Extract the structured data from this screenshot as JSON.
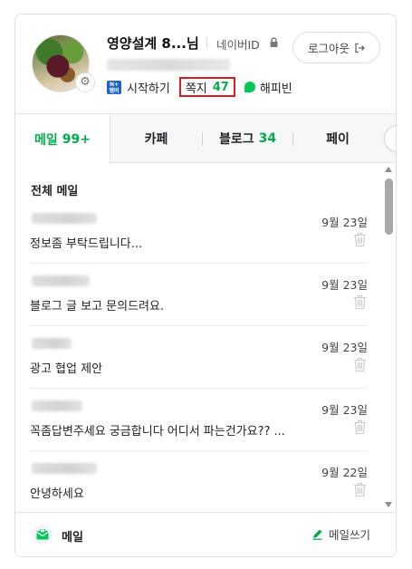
{
  "profile": {
    "name": "영양설계 8...님",
    "id_label": "네이버ID",
    "logout_label": "로그아웃",
    "links": {
      "start_badge": "N+",
      "start_badge_sub": "멤버십",
      "start_label": "시작하기",
      "note_label": "쪽지",
      "note_count": "47",
      "happybean_label": "해피빈"
    }
  },
  "tabs": [
    {
      "label": "메일",
      "count": "99+",
      "active": true
    },
    {
      "label": "카페",
      "count": ""
    },
    {
      "label": "블로그",
      "count": "34"
    },
    {
      "label": "페이",
      "count": ""
    }
  ],
  "mail": {
    "section_title": "전체 메일",
    "items": [
      {
        "date": "9월 23일",
        "subject": "정보좀 부탁드립니다..."
      },
      {
        "date": "9월 23일",
        "subject": "블로그 글 보고 문의드려요."
      },
      {
        "date": "9월 23일",
        "subject": "광고 협업 제안"
      },
      {
        "date": "9월 23일",
        "subject": "꼭좀답변주세요 궁금합니다 어디서 파는건가요?? ..."
      },
      {
        "date": "9월 22일",
        "subject": "안녕하세요"
      }
    ]
  },
  "footer": {
    "mail_label": "메일",
    "compose_label": "메일쓰기"
  },
  "colors": {
    "accent_green": "#03a94d",
    "highlight_red": "#d21f26",
    "tab_bar_bg": "#f6f7f8"
  },
  "icons": {
    "settings": "gear-icon",
    "lock": "lock-icon",
    "logout": "logout-icon",
    "next": "chevron-right-icon",
    "trash": "trash-icon",
    "mail": "mail-icon",
    "compose": "pencil-icon"
  }
}
